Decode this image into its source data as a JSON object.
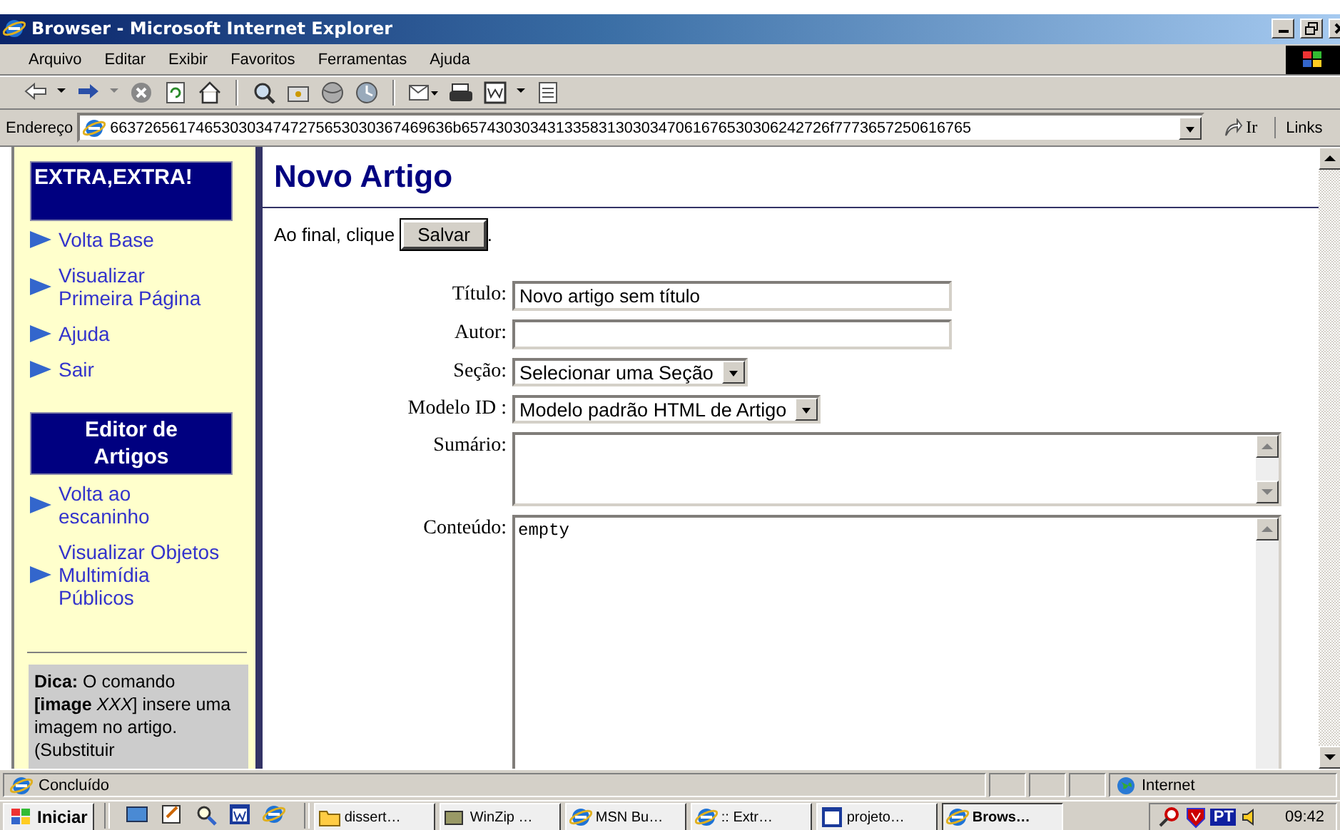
{
  "window": {
    "title": "Browser - Microsoft Internet Explorer"
  },
  "menu": [
    "Arquivo",
    "Editar",
    "Exibir",
    "Favoritos",
    "Ferramentas",
    "Ajuda"
  ],
  "address": {
    "label": "Endereço",
    "value": "6637265617465303034747275653030367469636b6574303034313358313030347061676530306242726f7773657250616765",
    "go": "Ir",
    "links": "Links"
  },
  "sidebar": {
    "header": "EXTRA,EXTRA!",
    "links": [
      "Volta Base",
      "Visualizar Primeira Página",
      "Ajuda",
      "Sair"
    ],
    "section_title": "Editor de Artigos",
    "section_links": [
      "Volta ao escaninho",
      "Visualizar Objetos Multimídia Públicos"
    ],
    "tip": "**Dica:** O comando **[image** *XXX*] insere uma imagem no artigo. (Substituir"
  },
  "page": {
    "title": "Novo Artigo",
    "instruction": "Ao final, clique",
    "save": "Salvar",
    "period": "."
  },
  "fields": [
    {
      "kind": "text",
      "label": "Título:",
      "value": "Novo artigo sem título"
    },
    {
      "kind": "text",
      "label": "Autor:"
    },
    {
      "kind": "select",
      "label": "Seção:",
      "value": "Selecionar uma Seção"
    },
    {
      "kind": "select",
      "label": "Modelo ID :",
      "value": "Modelo padrão HTML de Artigo"
    },
    {
      "kind": "textarea",
      "label": "Sumário:"
    },
    {
      "kind": "textarea",
      "label": "Conteúdo:",
      "value": "empty"
    }
  ],
  "status_bar": {
    "text": "Concluído",
    "zone": "Internet"
  },
  "taskbar": {
    "start": "Iniciar",
    "tasks": [
      {
        "label": "dissert…",
        "selected": false
      },
      {
        "label": "WinZip …",
        "selected": false
      },
      {
        "label": "MSN Bu…",
        "selected": false
      },
      {
        "label": ":: Extr…",
        "selected": false
      },
      {
        "label": "projeto…",
        "selected": false
      },
      {
        "label": "Brows…",
        "selected": true
      }
    ],
    "language": "PT",
    "clock": "09:42"
  }
}
